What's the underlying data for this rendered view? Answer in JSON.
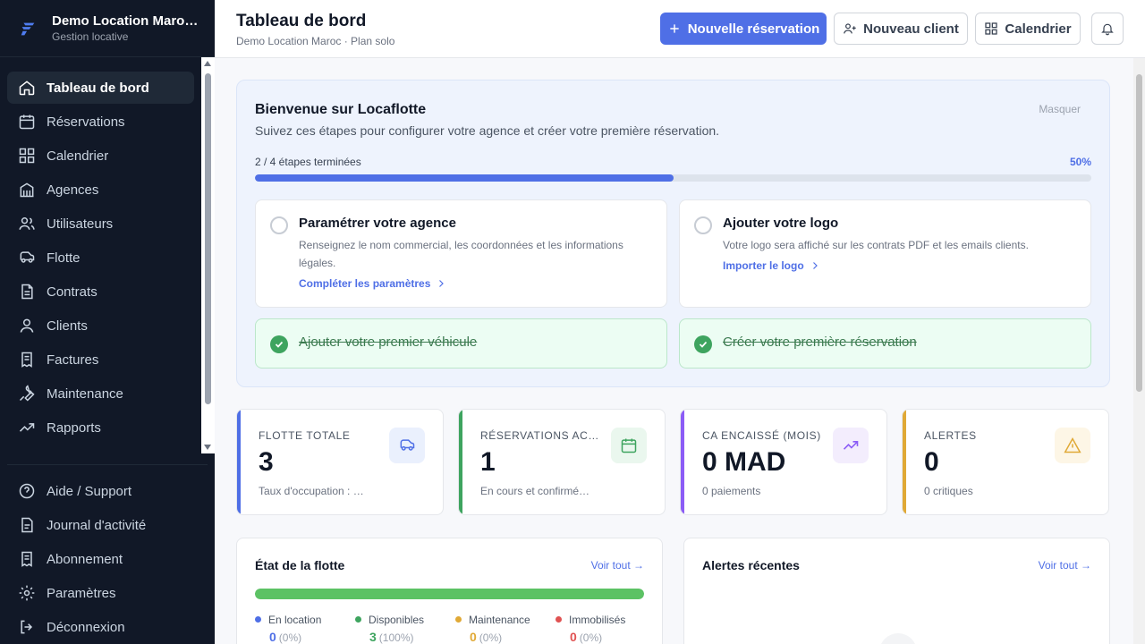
{
  "brand": {
    "title": "Demo Location Maroc…",
    "subtitle": "Gestion locative"
  },
  "sidebar": {
    "items": [
      {
        "label": "Tableau de bord",
        "icon": "home-icon",
        "active": true
      },
      {
        "label": "Réservations",
        "icon": "calendar-icon"
      },
      {
        "label": "Calendrier",
        "icon": "grid-icon"
      },
      {
        "label": "Agences",
        "icon": "building-icon"
      },
      {
        "label": "Utilisateurs",
        "icon": "users-icon"
      },
      {
        "label": "Flotte",
        "icon": "car-icon"
      },
      {
        "label": "Contrats",
        "icon": "document-icon"
      },
      {
        "label": "Clients",
        "icon": "user-icon"
      },
      {
        "label": "Factures",
        "icon": "receipt-icon"
      },
      {
        "label": "Maintenance",
        "icon": "wrench-icon"
      },
      {
        "label": "Rapports",
        "icon": "trend-icon"
      }
    ],
    "bottom_items": [
      {
        "label": "Aide / Support",
        "icon": "help-icon"
      },
      {
        "label": "Journal d'activité",
        "icon": "journal-icon"
      },
      {
        "label": "Abonnement",
        "icon": "receipt-icon"
      },
      {
        "label": "Paramètres",
        "icon": "gear-icon"
      },
      {
        "label": "Déconnexion",
        "icon": "logout-icon"
      }
    ]
  },
  "header": {
    "title": "Tableau de bord",
    "subtitle": "Demo Location Maroc · Plan solo",
    "new_reservation": "Nouvelle réservation",
    "new_client": "Nouveau client",
    "calendar": "Calendrier"
  },
  "welcome": {
    "title": "Bienvenue sur Locaflotte",
    "subtitle": "Suivez ces étapes pour configurer votre agence et créer votre première réservation.",
    "hide": "Masquer",
    "progress_label": "2 / 4 étapes terminées",
    "progress_pct": "50%",
    "progress_value": 50,
    "steps": [
      {
        "title": "Paramétrer votre agence",
        "desc": "Renseignez le nom commercial, les coordonnées et les informations légales.",
        "link": "Compléter les paramètres"
      },
      {
        "title": "Ajouter votre logo",
        "desc": "Votre logo sera affiché sur les contrats PDF et les emails clients.",
        "link": "Importer le logo"
      },
      {
        "title": "Ajouter votre premier véhicule"
      },
      {
        "title": "Créer votre première réservation"
      }
    ]
  },
  "stats": [
    {
      "label": "FLOTTE TOTALE",
      "value": "3",
      "note": "Taux d'occupation : …",
      "color": "#4f6fe6",
      "icon": "car-icon"
    },
    {
      "label": "RÉSERVATIONS AC…",
      "value": "1",
      "note": "En cours et confirmé…",
      "color": "#3ea45f",
      "icon": "calendar-icon"
    },
    {
      "label": "CA ENCAISSÉ (MOIS)",
      "value": "0 MAD",
      "note": "0 paiements",
      "color": "#8b5cf6",
      "icon": "trend-icon"
    },
    {
      "label": "ALERTES",
      "value": "0",
      "note": "0 critiques",
      "color": "#e0a936",
      "icon": "warning-icon"
    }
  ],
  "fleet": {
    "title": "État de la flotte",
    "link": "Voir tout →",
    "available_pct": 100,
    "legend": [
      {
        "label": "En location",
        "value": "0",
        "pct": "(0%)",
        "color": "#4f6fe6"
      },
      {
        "label": "Disponibles",
        "value": "3",
        "pct": "(100%)",
        "color": "#3ea45f"
      },
      {
        "label": "Maintenance",
        "value": "0",
        "pct": "(0%)",
        "color": "#e0a936"
      },
      {
        "label": "Immobilisés",
        "value": "0",
        "pct": "(0%)",
        "color": "#e05252"
      }
    ]
  },
  "alerts": {
    "title": "Alertes récentes",
    "link": "Voir tout →"
  }
}
